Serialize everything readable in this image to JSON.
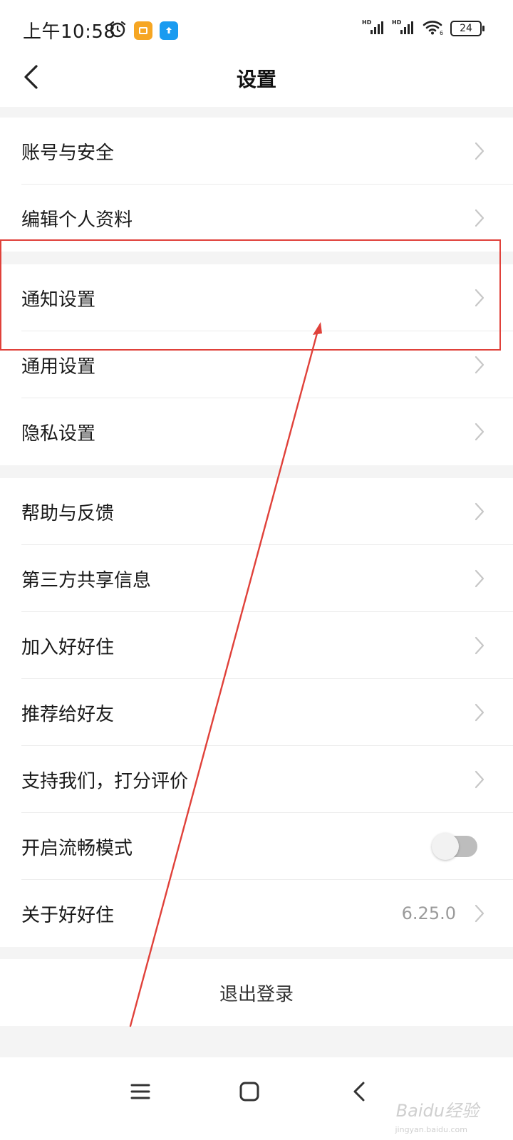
{
  "status_bar": {
    "time": "上午10:58",
    "battery": "24",
    "icons": [
      "alarm-icon",
      "gallery-app-icon",
      "upload-app-icon",
      "hd-signal-icon",
      "hd-signal-icon",
      "wifi-icon",
      "battery-icon"
    ]
  },
  "header": {
    "title": "设置",
    "back_icon": "chevron-left-icon"
  },
  "groups": [
    {
      "items": [
        {
          "label": "账号与安全",
          "control": "chevron"
        },
        {
          "label": "编辑个人资料",
          "control": "chevron"
        }
      ]
    },
    {
      "items": [
        {
          "label": "通知设置",
          "control": "chevron"
        },
        {
          "label": "通用设置",
          "control": "chevron"
        },
        {
          "label": "隐私设置",
          "control": "chevron"
        }
      ]
    },
    {
      "items": [
        {
          "label": "帮助与反馈",
          "control": "chevron"
        },
        {
          "label": "第三方共享信息",
          "control": "chevron"
        },
        {
          "label": "加入好好住",
          "control": "chevron"
        },
        {
          "label": "推荐给好友",
          "control": "chevron"
        },
        {
          "label": "支持我们，打分评价",
          "control": "chevron"
        },
        {
          "label": "开启流畅模式",
          "control": "toggle",
          "toggle_on": false
        },
        {
          "label": "关于好好住",
          "control": "chevron",
          "value": "6.25.0"
        }
      ]
    }
  ],
  "logout": {
    "label": "退出登录"
  },
  "system_nav": {
    "icons": [
      "menu-icon",
      "home-icon",
      "back-icon"
    ]
  },
  "annotation": {
    "highlight_color": "#e0413a",
    "highlighted_item": "通知设置"
  },
  "watermark": {
    "text": "Baidu经验",
    "sub": "jingyan.baidu.com"
  },
  "colors": {
    "background": "#f4f4f4",
    "surface": "#ffffff",
    "chevron": "#c7c7c7",
    "value_text": "#9a9a9a"
  }
}
